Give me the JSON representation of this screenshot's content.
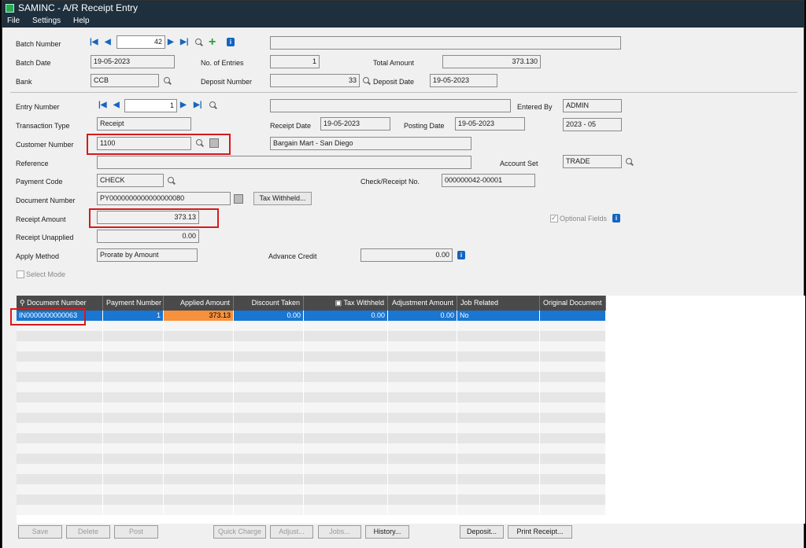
{
  "window": {
    "title": "SAMINC - A/R Receipt Entry"
  },
  "menu": {
    "file": "File",
    "settings": "Settings",
    "help": "Help"
  },
  "batch": {
    "number_label": "Batch Number",
    "number": "42",
    "date_label": "Batch Date",
    "date": "19-05-2023",
    "entries_label": "No. of Entries",
    "entries": "1",
    "total_label": "Total Amount",
    "total": "373.130",
    "bank_label": "Bank",
    "bank": "CCB",
    "deposit_label": "Deposit Number",
    "deposit": "33",
    "deposit_date_label": "Deposit Date",
    "deposit_date": "19-05-2023",
    "description": ""
  },
  "entry": {
    "number_label": "Entry Number",
    "number": "1",
    "description": "",
    "entered_by_label": "Entered By",
    "entered_by": "ADMIN",
    "type_label": "Transaction Type",
    "type": "Receipt",
    "receipt_date_label": "Receipt Date",
    "receipt_date": "19-05-2023",
    "posting_date_label": "Posting Date",
    "posting_date": "19-05-2023",
    "period": "2023 - 05",
    "customer_label": "Customer Number",
    "customer": "1100",
    "customer_name": "Bargain Mart - San Diego",
    "reference_label": "Reference",
    "reference": "",
    "account_set_label": "Account Set",
    "account_set": "TRADE",
    "payment_code_label": "Payment Code",
    "payment_code": "CHECK",
    "check_label": "Check/Receipt No.",
    "check": "000000042-00001",
    "document_label": "Document Number",
    "document": "PY0000000000000000080",
    "tax_withheld_button": "Tax Withheld...",
    "receipt_amount_label": "Receipt Amount",
    "receipt_amount": "373.13",
    "optional_fields_label": "Optional Fields",
    "unapplied_label": "Receipt Unapplied",
    "unapplied": "0.00",
    "apply_method_label": "Apply Method",
    "apply_method": "Prorate by Amount",
    "advance_credit_label": "Advance Credit",
    "advance_credit": "0.00",
    "select_mode_label": "Select Mode"
  },
  "grid": {
    "columns": [
      "Document Number",
      "Payment Number",
      "Applied Amount",
      "Discount Taken",
      "Tax Withheld",
      "Adjustment Amount",
      "Job Related",
      "Original Document"
    ],
    "rows": [
      [
        "IN0000000000063",
        "1",
        "373.13",
        "0.00",
        "0.00",
        "0.00",
        "No",
        ""
      ]
    ]
  },
  "buttons": {
    "save": "Save",
    "delete": "Delete",
    "post": "Post",
    "quick_charge": "Quick Charge",
    "adjust": "Adjust...",
    "jobs": "Jobs...",
    "history": "History...",
    "deposit": "Deposit...",
    "print_receipt": "Print Receipt..."
  },
  "colors": {
    "titlebar": "#1e2f3d",
    "selection": "#1976d2",
    "applied": "#f7913b",
    "highlight": "#d7191c"
  }
}
